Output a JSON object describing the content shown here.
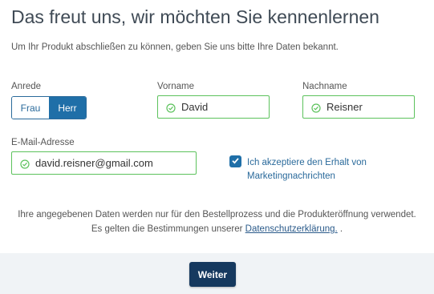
{
  "header": {
    "title": "Das freut uns, wir möchten Sie kennenlernen",
    "intro": "Um Ihr Produkt abschließen zu können, geben Sie uns bitte Ihre Daten bekannt."
  },
  "form": {
    "anrede": {
      "label": "Anrede",
      "options": [
        "Frau",
        "Herr"
      ],
      "selected": "Herr"
    },
    "vorname": {
      "label": "Vorname",
      "value": "David"
    },
    "nachname": {
      "label": "Nachname",
      "value": "Reisner"
    },
    "email": {
      "label": "E-Mail-Adresse",
      "value": "david.reisner@gmail.com"
    },
    "marketing": {
      "checked": true,
      "label": "Ich akzeptiere den Erhalt von Marketingnachrichten"
    }
  },
  "disclaimer": {
    "line1": "Ihre angegebenen Daten werden nur für den Bestellprozess und die Produkteröffnung verwendet.",
    "line2_prefix": "Es gelten die Bestimmungen unserer",
    "link": "Datenschutzerklärung.",
    "line2_suffix": "."
  },
  "footer": {
    "next_label": "Weiter"
  },
  "colors": {
    "accent": "#1f6fa8",
    "valid": "#5cc25c",
    "button": "#16395f",
    "footer_bg": "#f0f3f6"
  },
  "icons": {
    "valid": "check-circle-icon",
    "checkbox": "checkmark-icon"
  }
}
